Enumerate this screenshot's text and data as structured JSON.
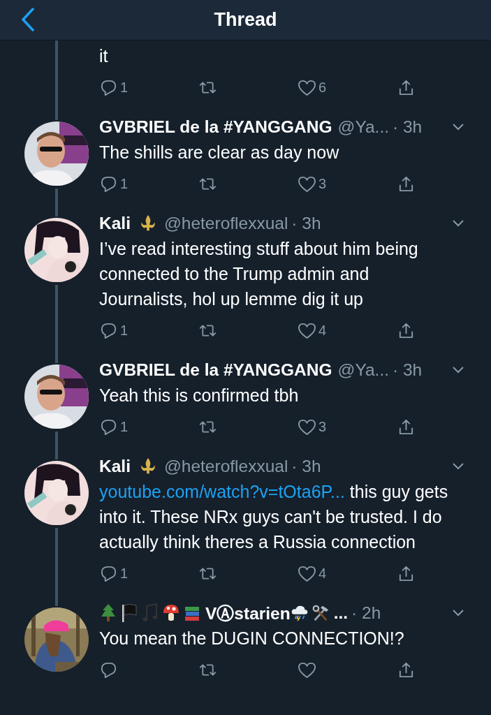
{
  "header": {
    "title": "Thread"
  },
  "tweets": [
    {
      "kind": "partial",
      "text": [
        {
          "kind": "text",
          "value": "it"
        }
      ],
      "replies": "1",
      "likes": "6"
    },
    {
      "kind": "gabriel",
      "name": "GVBRIEL de la #YANGGANG",
      "handle": "@Ya...",
      "time": "· 3h",
      "text": [
        {
          "kind": "text",
          "value": "The shills are clear as day now"
        }
      ],
      "replies": "1",
      "likes": "3"
    },
    {
      "kind": "kali",
      "name": "Kali",
      "handle": "@heteroflexxual",
      "time": "· 3h",
      "text": [
        {
          "kind": "text",
          "value": "I’ve read interesting stuff about him being connected to the Trump admin and Journalists, hol up lemme dig it up"
        }
      ],
      "replies": "1",
      "likes": "4"
    },
    {
      "kind": "gabriel",
      "name": "GVBRIEL de la #YANGGANG",
      "handle": "@Ya...",
      "time": "· 3h",
      "text": [
        {
          "kind": "text",
          "value": "Yeah this is confirmed tbh"
        }
      ],
      "replies": "1",
      "likes": "3"
    },
    {
      "kind": "kali",
      "name": "Kali",
      "handle": "@heteroflexxual",
      "time": "· 3h",
      "text": [
        {
          "kind": "link",
          "value": "youtube.com/watch?v=tOta6P..."
        },
        {
          "kind": "text",
          "value": " this guy gets into it. These NRx guys can't be trusted. I do actually think theres a Russia connection"
        }
      ],
      "replies": "1",
      "likes": "4"
    },
    {
      "kind": "vastarien",
      "name": "VⒶstarien",
      "name_suffix": "...",
      "time": "· 2h",
      "text": [
        {
          "kind": "text",
          "value": "You mean the DUGIN CONNECTION!?"
        }
      ]
    }
  ]
}
